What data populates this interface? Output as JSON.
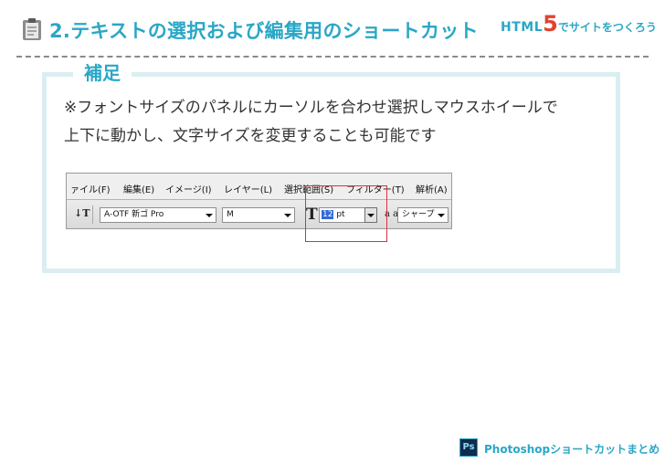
{
  "header": {
    "title": "2.テキストの選択および編集用のショートカット",
    "brand_html": "HTML",
    "brand_five": "5",
    "brand_tagline": "でサイトをつくろう"
  },
  "note": {
    "label": "補足",
    "line1": "※フォントサイズのパネルにカーソルを合わせ選択しマウスホイールで",
    "line2": "上下に動かし、文字サイズを変更することも可能です"
  },
  "toolbar": {
    "menu": [
      "ァイル(F)",
      "編集(E)",
      "イメージ(I)",
      "レイヤー(L)",
      "選択範囲(S)",
      "フィルター(T)",
      "解析(A)"
    ],
    "tool_glyph": "↓T",
    "font_family": "A-OTF 新ゴ Pro",
    "font_style": "M",
    "size_glyph": "T",
    "font_size": "12",
    "font_size_unit": " pt",
    "aa_glyph": "a a",
    "antialias": "シャープ"
  },
  "footer": {
    "badge": "Ps",
    "label": "Photoshopショートカットまとめ"
  },
  "colors": {
    "accent": "#2aa7c6",
    "brand_red": "#e0442e",
    "note_border": "#daeef2",
    "highlight": "#d9313f",
    "selection": "#3168d5"
  }
}
